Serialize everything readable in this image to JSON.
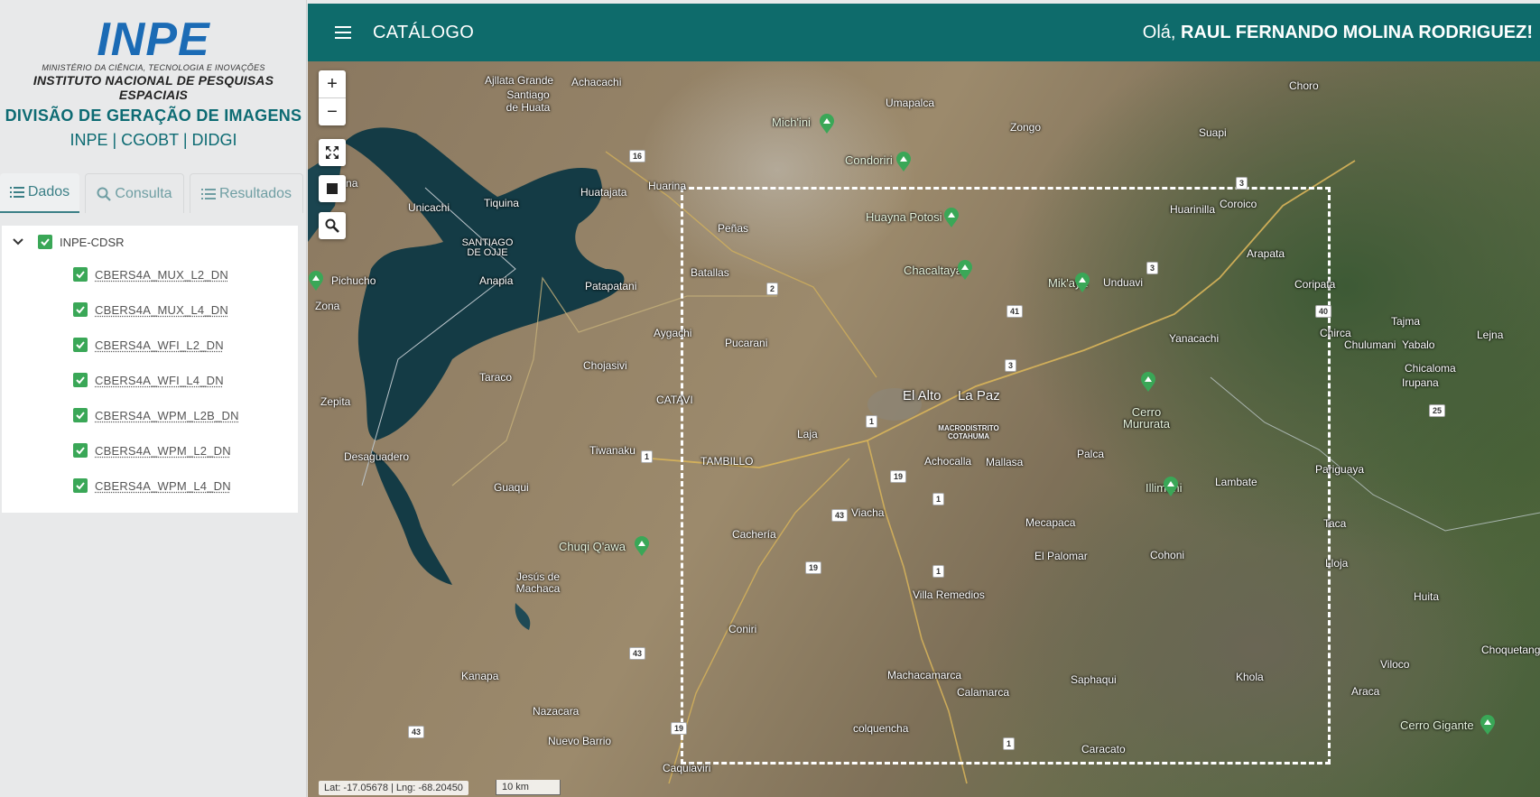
{
  "logo": {
    "name": "INPE",
    "ministry": "MINISTÉRIO DA CIÊNCIA, TECNOLOGIA E INOVAÇÕES",
    "institute": "INSTITUTO NACIONAL DE PESQUISAS ESPACIAIS"
  },
  "sidebar": {
    "division": "DIVISÃO DE GERAÇÃO DE IMAGENS",
    "subdivision": "INPE | CGOBT | DIDGI",
    "tabs": [
      {
        "label": "Dados",
        "icon": "list-icon"
      },
      {
        "label": "Consulta",
        "icon": "search-icon"
      },
      {
        "label": "Resultados",
        "icon": "list-icon"
      }
    ],
    "tree": {
      "root": "INPE-CDSR",
      "items": [
        "CBERS4A_MUX_L2_DN",
        "CBERS4A_MUX_L4_DN",
        "CBERS4A_WFI_L2_DN",
        "CBERS4A_WFI_L4_DN",
        "CBERS4A_WPM_L2B_DN",
        "CBERS4A_WPM_L2_DN",
        "CBERS4A_WPM_L4_DN"
      ]
    }
  },
  "header": {
    "title": "CATÁLOGO",
    "greeting": "Olá,",
    "user": "RAUL FERNANDO MOLINA RODRIGUEZ!"
  },
  "map": {
    "zoom_in": "+",
    "zoom_out": "−",
    "coords": "Lat: -17.05678 | Lng: -68.20450",
    "scale": "10 km",
    "labels": {
      "ajllata": "Ajllata Grande",
      "achacachi": "Achacachi",
      "santiago_huata": "Santiago de Huata",
      "michini": "Mich'ini",
      "umapalca": "Umapalca",
      "zongo": "Zongo",
      "choro": "Choro",
      "suapi": "Suapi",
      "condoriri": "Condoriri",
      "huarina": "Huarina",
      "huatajata": "Huatajata",
      "unicachi": "Unicachi",
      "tiquina": "Tiquina",
      "copacabana": "abana",
      "santiago_ojje": "SANTIAGO DE OJJE",
      "penas": "Peñas",
      "huayna": "Huayna Potosi",
      "huarinilla": "Huarinilla",
      "coroico": "Coroico",
      "pichucho": "Pichucho",
      "anapia": "Anapia",
      "patapatani": "Patapatani",
      "batallas": "Batallas",
      "chacaltaya": "Chacaltaya",
      "unduavi": "Unduavi",
      "arapata": "Arapata",
      "coripata": "Coripata",
      "zona": "Zona",
      "mikaya": "Mik'aya",
      "aygachi": "Aygachi",
      "pucarani": "Pucarani",
      "yanacachi": "Yanacachi",
      "chirca": "Chirca",
      "tajma": "Tajma",
      "chulumani": "Chulumani",
      "yabalo": "Yabalo",
      "lejna": "Lejna",
      "chojasivi": "Chojasivi",
      "taraco": "Taraco",
      "chicaloma": "Chicaloma",
      "irupana": "Irupana",
      "catavi": "CATAVI",
      "zepita": "Zepita",
      "el_alto": "El Alto",
      "la_paz": "La Paz",
      "cerro_mururata": "Cerro Mururata",
      "laja": "Laja",
      "macrodistrito": "MACRODISTRITO COTAHUMA",
      "tiwanaku": "Tiwanaku",
      "palca": "Palca",
      "achocalla": "Achocalla",
      "mallasa": "Mallasa",
      "desaguadero": "Desaguadero",
      "tambillo": "TAMBILLO",
      "pariguaya": "Pariguaya",
      "guaqui": "Guaqui",
      "illimani": "Illimani",
      "lambate": "Lambate",
      "viacha": "Viacha",
      "cacheria": "Cachería",
      "mecapaca": "Mecapaca",
      "taca": "Taca",
      "chuqi": "Chuqi Q'awa",
      "el_palomar": "El Palomar",
      "cohoni": "Cohoni",
      "lloja": "Lloja",
      "jesus": "Jesús de Machaca",
      "villa_remedios": "Villa Remedios",
      "huita": "Huita",
      "coniri": "Coniri",
      "choquetanga": "Choquetanga",
      "viloco": "Viloco",
      "kanapa": "Kanapa",
      "machacamarca": "Machacamarca",
      "saphaqui": "Saphaqui",
      "khola": "Khola",
      "araca": "Araca",
      "calamarca": "Calamarca",
      "nazacara": "Nazacara",
      "colquencha": "colquencha",
      "cerro_gigante": "Cerro Gigante",
      "nuevo_barrio": "Nuevo Barrio",
      "caracato": "Caracato",
      "caquiaviri": "Caquiaviri"
    },
    "roads": [
      "16",
      "3",
      "2",
      "41",
      "3",
      "40",
      "3",
      "25",
      "1",
      "1",
      "19",
      "43",
      "1",
      "19",
      "1",
      "43",
      "43",
      "19",
      "1"
    ]
  }
}
